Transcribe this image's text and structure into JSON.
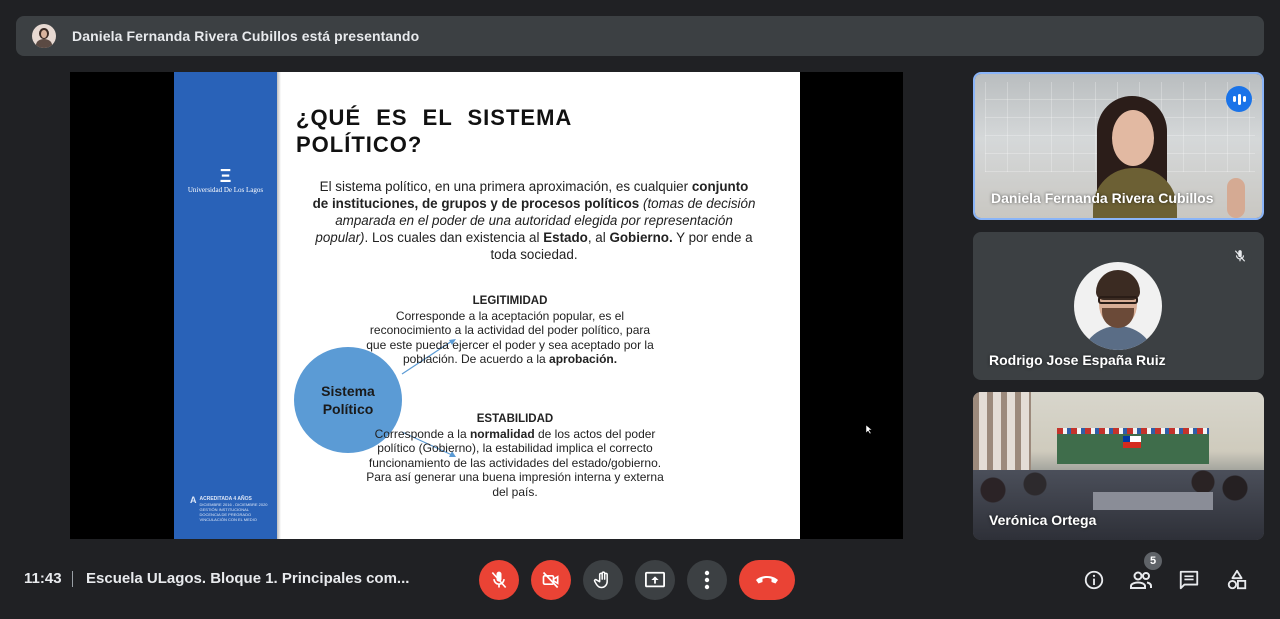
{
  "presenter_banner": {
    "text": "Daniela Fernanda Rivera Cubillos está presentando"
  },
  "slide": {
    "title": "¿QUÉ ES EL SISTEMA POLÍTICO?",
    "logo": {
      "mark": "Ξ",
      "name": "Universidad De Los Lagos"
    },
    "accreditation": {
      "logo": "A",
      "heading": "ACREDITADA 4 AÑOS",
      "lines": [
        "DICIEMBRE 2016 - DICIEMBRE 2020",
        "GESTIÓN INSTITUCIONAL",
        "DOCENCIA DE PREGRADO",
        "VINCULACIÓN CON EL MEDIO"
      ]
    },
    "intro": {
      "part1": "El sistema político, en una primera aproximación, es cualquier",
      "bold1": "conjunto de instituciones, de grupos y de procesos políticos",
      "italic": "(tomas de decisión amparada en el poder de una autoridad elegida por representación popular)",
      "part2": ". Los cuales dan existencia al",
      "bold2": "Estado",
      "part3": ", al",
      "bold3": "Gobierno.",
      "part4": "Y por ende a toda sociedad."
    },
    "circle_label": "Sistema Político",
    "legitimidad": {
      "heading": "LEGITIMIDAD",
      "text": "Corresponde a la aceptación popular, es el reconocimiento a la actividad del poder político, para que este pueda ejercer el poder y sea aceptado por la población. De acuerdo a la",
      "bold": "aprobación."
    },
    "estabilidad": {
      "heading": "ESTABILIDAD",
      "text1": "Corresponde a la",
      "bold": "normalidad",
      "text2": "de los actos del poder político (Gobierno), la estabilidad implica el correcto funcionamiento de las actividades del estado/gobierno. Para así generar una buena impresión interna y externa del país."
    }
  },
  "participants": [
    {
      "name": "Daniela Fernanda Rivera Cubillos",
      "speaking": true
    },
    {
      "name": "Rodrigo Jose España Ruiz",
      "muted": true
    },
    {
      "name": "Verónica Ortega"
    }
  ],
  "bottom_bar": {
    "time": "11:43",
    "meeting_title": "Escuela ULagos. Bloque 1. Principales com...",
    "people_count": "5"
  },
  "colors": {
    "background": "#202124",
    "surface": "#3c4043",
    "danger": "#ea4335",
    "accent": "#1a73e8",
    "slide_band": "#2962b8",
    "circle": "#5b9bd5"
  },
  "icons": [
    "mic-off-icon",
    "camera-off-icon",
    "raise-hand-icon",
    "present-icon",
    "more-vert-icon",
    "call-end-icon",
    "info-icon",
    "people-icon",
    "chat-icon",
    "activities-icon",
    "audio-level-icon"
  ]
}
